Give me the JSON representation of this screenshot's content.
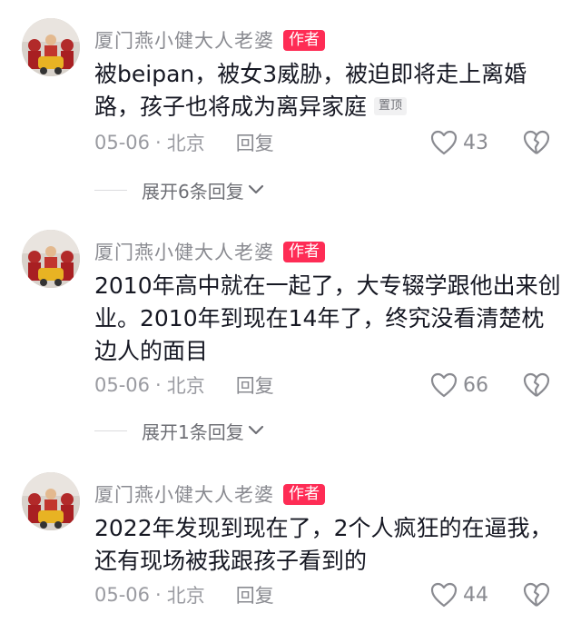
{
  "comments": [
    {
      "username": "厦门燕小健大人老婆",
      "badge": "作者",
      "text": "被beipan，被女3威胁，被迫即将走上离婚路，孩子也将成为离异家庭",
      "pinned_label": "置顶",
      "date": "05-06",
      "separator": "·",
      "location": "北京",
      "reply_label": "回复",
      "likes": "43",
      "expand_label": "展开6条回复"
    },
    {
      "username": "厦门燕小健大人老婆",
      "badge": "作者",
      "text": "2010年高中就在一起了，大专辍学跟他出来创业。2010年到现在14年了，终究没看清楚枕边人的面目",
      "date": "05-06",
      "separator": "·",
      "location": "北京",
      "reply_label": "回复",
      "likes": "66",
      "expand_label": "展开1条回复"
    },
    {
      "username": "厦门燕小健大人老婆",
      "badge": "作者",
      "text": "2022年发现到现在了，2个人疯狂的在逼我，还有现场被我跟孩子看到的",
      "date": "05-06",
      "separator": "·",
      "location": "北京",
      "reply_label": "回复",
      "likes": "44"
    }
  ],
  "colors": {
    "badge": "#fe2c55",
    "secondary_text": "#8a8b91",
    "primary_text": "#161823"
  }
}
